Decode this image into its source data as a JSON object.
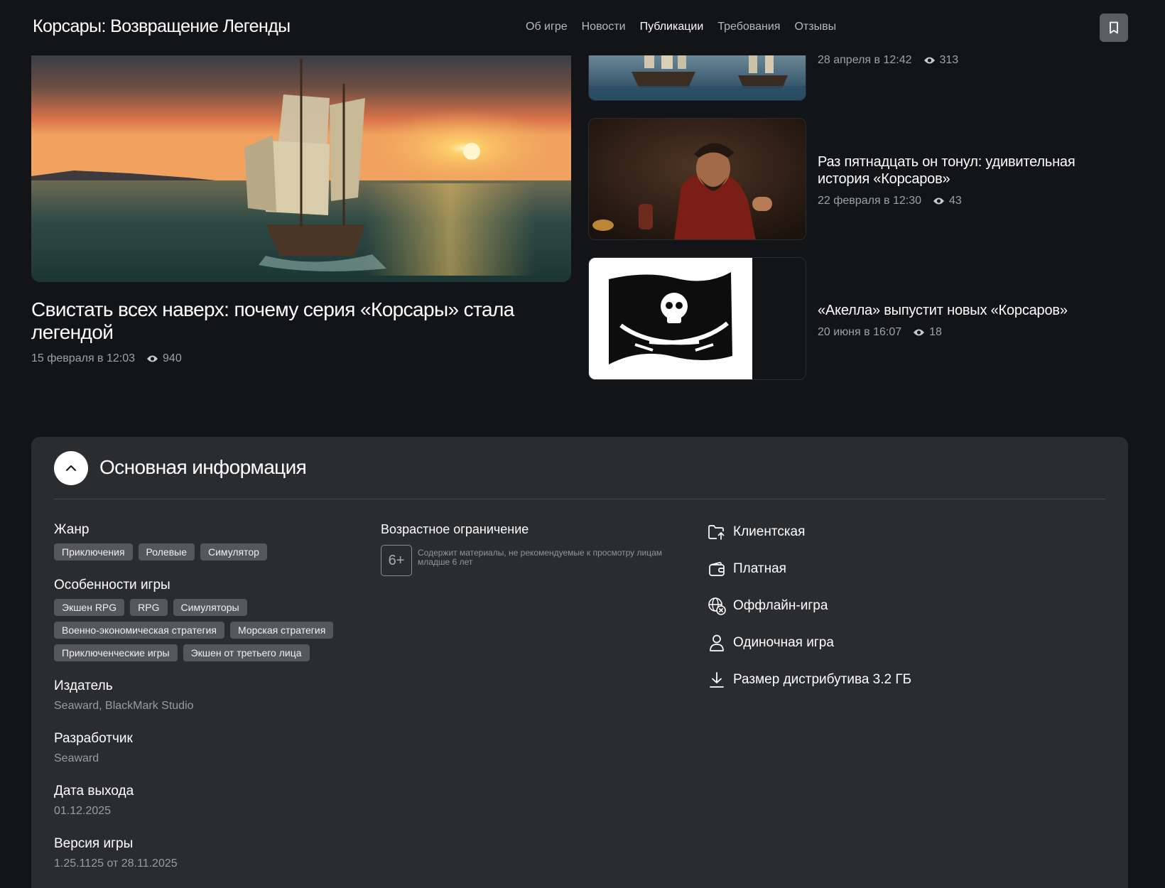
{
  "header": {
    "title": "Корсары: Возвращение Легенды",
    "nav": [
      "Об игре",
      "Новости",
      "Публикации",
      "Требования",
      "Отзывы"
    ],
    "active_nav": "Публикации",
    "bookmark_icon": "bookmark-icon"
  },
  "publications": {
    "featured": {
      "title": "Свистать всех наверх: почему серия «Корсары» стала легендой",
      "date": "15 февраля в 12:03",
      "views": "940"
    },
    "items": [
      {
        "title": "",
        "date": "28 апреля в 12:42",
        "views": "313"
      },
      {
        "title": "Раз пятнадцать он тонул: удивительная история «Корсаров»",
        "date": "22 февраля в 12:30",
        "views": "43"
      },
      {
        "title": "«Акелла» выпустит новых «Корсаров»",
        "date": "20 июня в 16:07",
        "views": "18"
      }
    ]
  },
  "info": {
    "title": "Основная информация",
    "genre_label": "Жанр",
    "genres": [
      "Приключения",
      "Ролевые",
      "Симулятор"
    ],
    "features_label": "Особенности игры",
    "features_tags": [
      [
        "Экшен RPG",
        "RPG",
        "Симуляторы"
      ],
      [
        "Военно-экономическая стратегия",
        "Морская стратегия"
      ],
      [
        "Приключенческие игры",
        "Экшен от третьего лица"
      ]
    ],
    "publisher_label": "Издатель",
    "publisher": "Seaward, BlackMark Studio",
    "developer_label": "Разработчик",
    "developer": "Seaward",
    "release_label": "Дата выхода",
    "release": "01.12.2025",
    "version_label": "Версия игры",
    "version": "1.25.1125 от 28.11.2025",
    "age_label": "Возрастное ограничение",
    "age_rating": "6+",
    "age_text": "Содержит материалы, не рекомендуемые к просмотру лицам младше 6 лет",
    "attributes": [
      {
        "label": "Клиентская",
        "icon": "folder-upload-icon"
      },
      {
        "label": "Платная",
        "icon": "wallet-icon"
      },
      {
        "label": "Оффлайн-игра",
        "icon": "globe-offline-icon"
      },
      {
        "label": "Одиночная игра",
        "icon": "user-icon"
      },
      {
        "label": "Размер дистрибутива 3.2 ГБ",
        "icon": "download-icon"
      }
    ]
  },
  "colors": {
    "background": "#131417",
    "panel": "#2b2c2f",
    "tag": "#55575c",
    "muted_text": "#9a9ca1"
  }
}
